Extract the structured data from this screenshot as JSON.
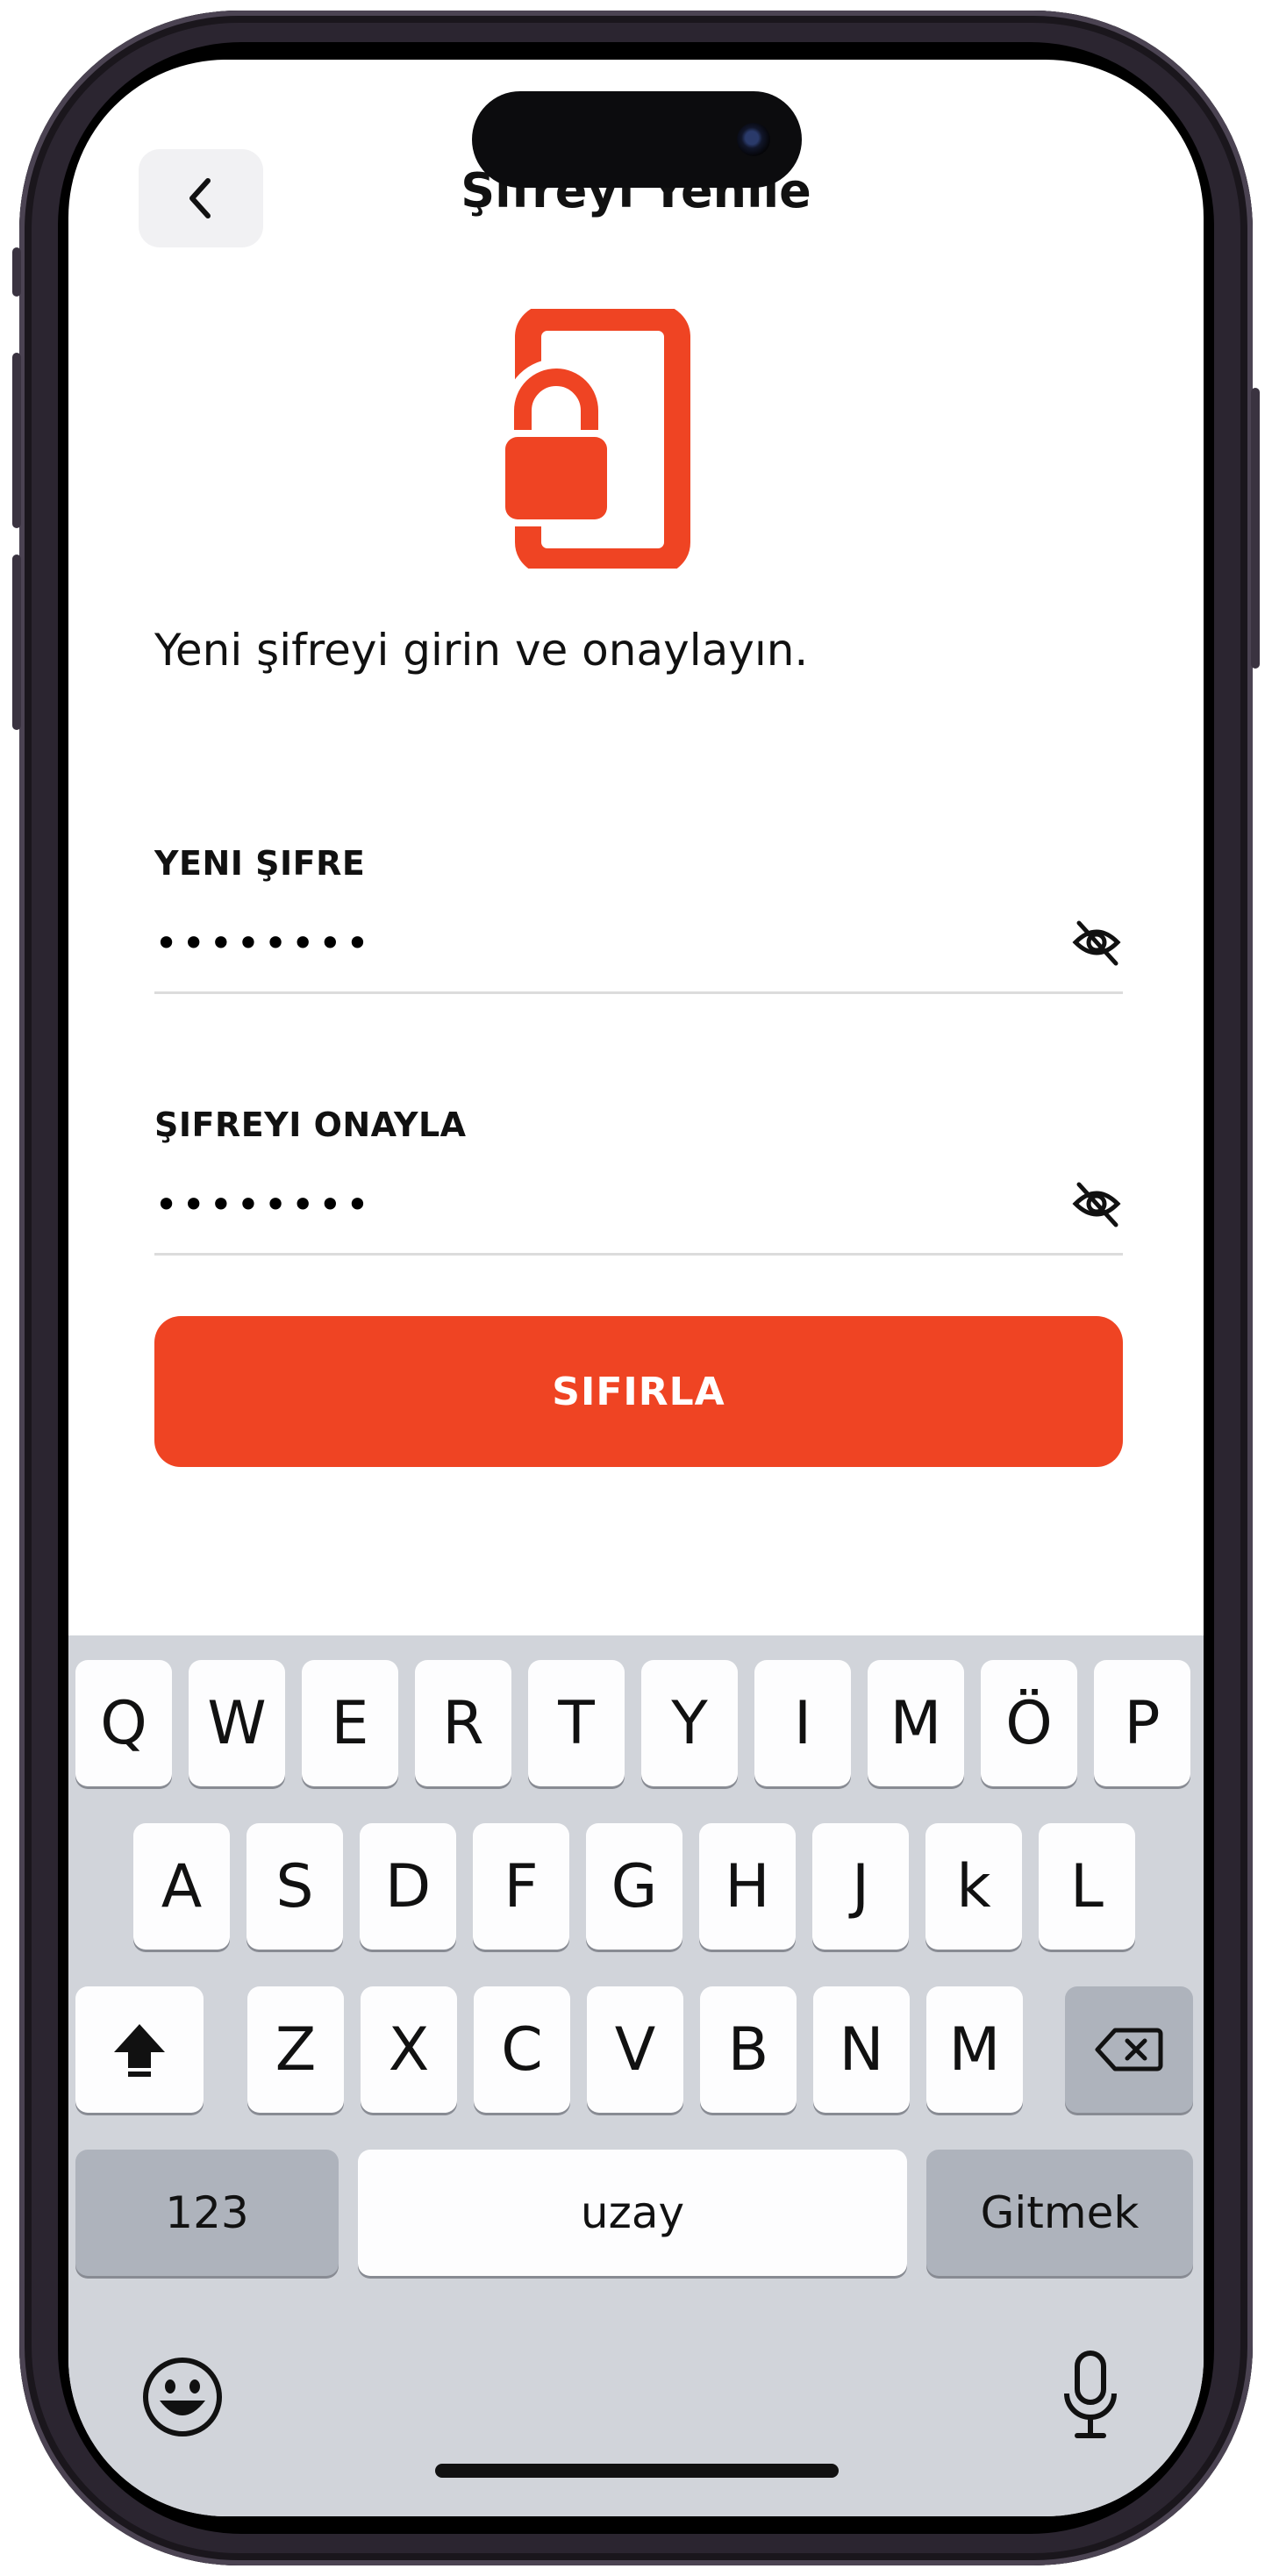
{
  "header": {
    "title": "Şifreyi Yenile",
    "back_icon": "chevron-left-icon"
  },
  "hero": {
    "icon": "phone-lock-icon",
    "accent_color": "#ef4423"
  },
  "subtitle": "Yeni şifreyi girin ve onaylayın.",
  "new_password": {
    "label": "YENI ŞIFRE",
    "value": "••••••••",
    "toggle_icon": "eye-slash-icon"
  },
  "confirm_password": {
    "label": "ŞIFREYI ONAYLA",
    "value": "••••••••",
    "toggle_icon": "eye-slash-icon"
  },
  "reset_button": {
    "label": "SIFIRLA"
  },
  "keyboard": {
    "row1": [
      "Q",
      "W",
      "E",
      "R",
      "T",
      "Y",
      "I",
      "M",
      "Ö",
      "P"
    ],
    "row2": [
      "A",
      "S",
      "D",
      "F",
      "G",
      "H",
      "J",
      "k",
      "L"
    ],
    "row3": [
      "Z",
      "X",
      "C",
      "V",
      "B",
      "N",
      "M"
    ],
    "numbers_label": "123",
    "space_label": "uzay",
    "go_label": "Gitmek",
    "shift_icon": "shift-icon",
    "delete_icon": "backspace-icon",
    "emoji_icon": "emoji-icon",
    "mic_icon": "microphone-icon"
  }
}
